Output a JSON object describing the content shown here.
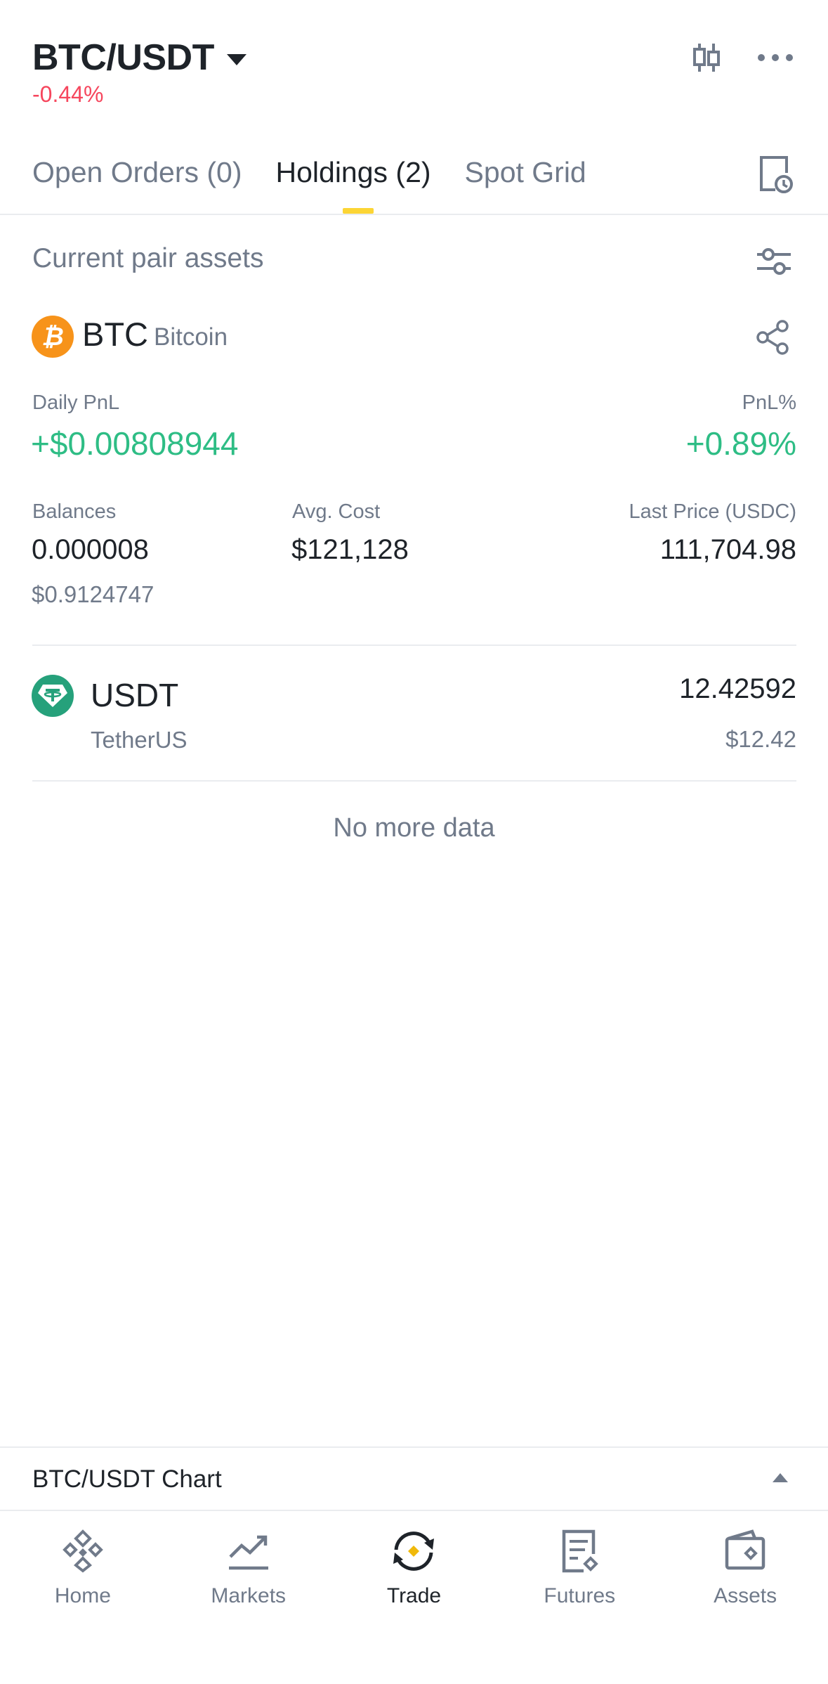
{
  "header": {
    "pair": "BTC/USDT",
    "change": "-0.44%",
    "chart_icon": "candlestick-icon",
    "more_icon": "more-dots-icon"
  },
  "tabs": [
    {
      "label": "Open Orders (0)",
      "active": false
    },
    {
      "label": "Holdings (2)",
      "active": true
    },
    {
      "label": "Spot Grid",
      "active": false
    }
  ],
  "section": {
    "title": "Current pair assets"
  },
  "btc": {
    "symbol": "BTC",
    "name": "Bitcoin",
    "daily_pnl_label": "Daily PnL",
    "daily_pnl_value": "+$0.00808944",
    "pnl_pct_label": "PnL%",
    "pnl_pct_value": "+0.89%",
    "balances_label": "Balances",
    "balance": "0.000008",
    "balance_usd": "$0.9124747",
    "avg_cost_label": "Avg. Cost",
    "avg_cost": "$121,128",
    "last_price_label": "Last Price (USDC)",
    "last_price": "111,704.98"
  },
  "usdt": {
    "symbol": "USDT",
    "name": "TetherUS",
    "amount": "12.42592",
    "amount_usd": "$12.42"
  },
  "no_more": "No more data",
  "chart_bar": {
    "label": "BTC/USDT Chart"
  },
  "nav": [
    {
      "label": "Home",
      "icon": "home-icon",
      "active": false
    },
    {
      "label": "Markets",
      "icon": "markets-icon",
      "active": false
    },
    {
      "label": "Trade",
      "icon": "trade-icon",
      "active": true
    },
    {
      "label": "Futures",
      "icon": "futures-icon",
      "active": false
    },
    {
      "label": "Assets",
      "icon": "assets-icon",
      "active": false
    }
  ],
  "colors": {
    "negative": "#f6465d",
    "positive": "#2ebd85",
    "accent": "#fcd535",
    "btc": "#f7931a",
    "usdt": "#26a17b"
  }
}
